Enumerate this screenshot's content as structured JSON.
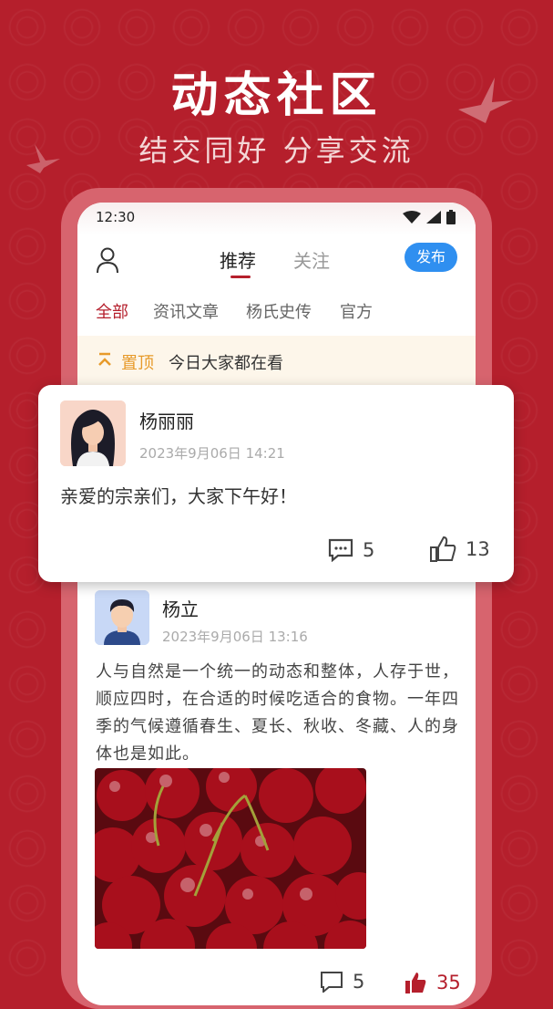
{
  "header": {
    "title": "动态社区",
    "subtitle": "结交同好 分享交流"
  },
  "statusbar": {
    "time": "12:30"
  },
  "nav": {
    "tabs": [
      "推荐",
      "关注"
    ],
    "publish_label": "发布"
  },
  "categories": [
    "全部",
    "资讯文章",
    "杨氏史传",
    "官方"
  ],
  "pinned": {
    "label": "置顶",
    "text": "今日大家都在看"
  },
  "posts": [
    {
      "author": "杨丽丽",
      "date": "2023年9月06日 14:21",
      "content": "亲爱的宗亲们，大家下午好！",
      "comments": "5",
      "likes": "13"
    },
    {
      "author": "杨立",
      "date": "2023年9月06日 13:16",
      "content": "人与自然是一个统一的动态和整体，人存于世，顺应四时，在合适的时候吃适合的食物。一年四季的气候遵循春生、夏长、秋收、冬藏、人的身体也是如此。",
      "comments": "5",
      "likes": "35"
    }
  ],
  "colors": {
    "brand_red": "#b51f2c",
    "accent_blue": "#2f8ff0",
    "pin_orange": "#e79a2a"
  }
}
